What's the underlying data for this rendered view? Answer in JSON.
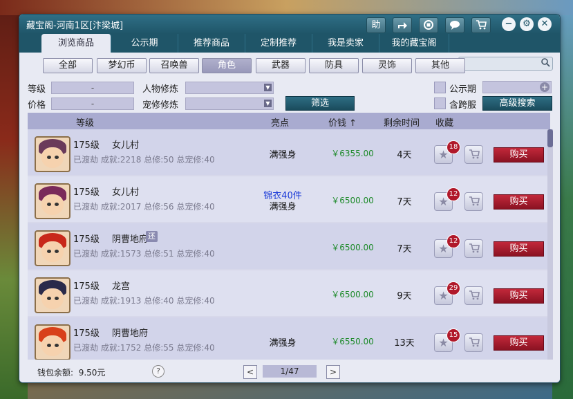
{
  "window": {
    "title": "藏宝阁-河南1区[汴梁城]"
  },
  "titlebar_buttons": {
    "help_label": "助",
    "icons": [
      "share-icon",
      "stop-icon",
      "chat-icon",
      "cart-icon"
    ]
  },
  "tabs": [
    {
      "label": "浏览商品",
      "active": true
    },
    {
      "label": "公示期"
    },
    {
      "label": "推荐商品"
    },
    {
      "label": "定制推荐"
    },
    {
      "label": "我是卖家"
    },
    {
      "label": "我的藏宝阁"
    }
  ],
  "search": {
    "placeholder": ""
  },
  "categories": [
    {
      "label": "全部"
    },
    {
      "label": "梦幻币"
    },
    {
      "label": "召唤兽"
    },
    {
      "label": "角色",
      "active": true
    },
    {
      "label": "武器"
    },
    {
      "label": "防具"
    },
    {
      "label": "灵饰"
    },
    {
      "label": "其他"
    }
  ],
  "filters": {
    "level_label": "等级",
    "level_value": "-",
    "price_label": "价格",
    "price_value": "-",
    "char_cultivation_label": "人物修炼",
    "pet_cultivation_label": "宠修修炼",
    "filter_button": "筛选",
    "publicity_label": "公示期",
    "cross_server_label": "含跨服",
    "advanced_search_button": "高级搜索"
  },
  "table_header": {
    "level": "等级",
    "highlight": "亮点",
    "price": "价钱",
    "price_sort_icon": "sort-up-arrow-icon",
    "time": "剩余时间",
    "favorite": "收藏"
  },
  "rows": [
    {
      "level": "175级",
      "school": "女儿村",
      "stats": "已渡劫 成就:2218 总修:50 总宠修:40",
      "highlight1": "满强身",
      "highlight2": "",
      "price": "￥6355.00",
      "time": "4天",
      "fav": "18",
      "buy": "购买",
      "avatar_hair": "#6a3a5a",
      "tag": ""
    },
    {
      "level": "175级",
      "school": "女儿村",
      "stats": "已渡劫 成就:2017 总修:56 总宠修:40",
      "highlight1": "锦衣40件",
      "highlight2": "满强身",
      "price": "￥6500.00",
      "time": "7天",
      "fav": "12",
      "buy": "购买",
      "avatar_hair": "#7a2a5a",
      "tag": ""
    },
    {
      "level": "175级",
      "school": "阴曹地府",
      "stats": "已渡劫 成就:1573 总修:51 总宠修:40",
      "highlight1": "",
      "highlight2": "",
      "price": "￥6500.00",
      "time": "7天",
      "fav": "12",
      "buy": "购买",
      "avatar_hair": "#c8281a",
      "tag": "还"
    },
    {
      "level": "175级",
      "school": "龙宫",
      "stats": "已渡劫 成就:1913 总修:40 总宠修:40",
      "highlight1": "",
      "highlight2": "",
      "price": "￥6500.00",
      "time": "9天",
      "fav": "29",
      "buy": "购买",
      "avatar_hair": "#2a2a4a",
      "tag": ""
    },
    {
      "level": "175级",
      "school": "阴曹地府",
      "stats": "已渡劫 成就:1752 总修:55 总宠修:40",
      "highlight1": "满强身",
      "highlight2": "",
      "price": "￥6550.00",
      "time": "13天",
      "fav": "15",
      "buy": "购买",
      "avatar_hair": "#d8401a",
      "tag": ""
    }
  ],
  "footer": {
    "wallet_label": "钱包余额:",
    "wallet_value": "9.50元",
    "help": "?",
    "page": "1/47",
    "prev": "<",
    "next": ">"
  }
}
